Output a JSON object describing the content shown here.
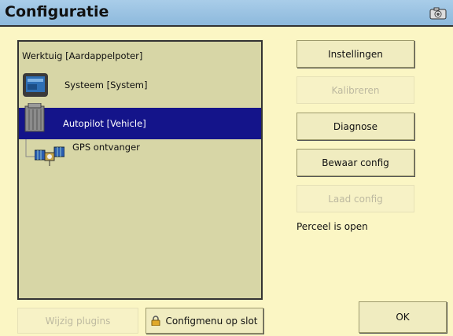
{
  "window": {
    "title": "Configuratie"
  },
  "tree": {
    "header": "Werktuig [Aardappelpoter]",
    "items": [
      {
        "label": "Systeem [System]",
        "icon": "display-unit-icon",
        "selected": false
      },
      {
        "label": "Autopilot [Vehicle]",
        "icon": "autopilot-controller-icon",
        "selected": true
      },
      {
        "label": "GPS ontvanger",
        "icon": "satellite-icon",
        "selected": false
      }
    ]
  },
  "buttons": {
    "instellingen": "Instellingen",
    "kalibreren": "Kalibreren",
    "diagnose": "Diagnose",
    "bewaar_config": "Bewaar config",
    "laad_config": "Laad config",
    "wijzig_plugins": "Wijzig plugins",
    "configmenu_lock": "Configmenu op slot",
    "ok": "OK"
  },
  "status": "Perceel is open",
  "colors": {
    "title_bar": "#8db9dc",
    "background": "#fbf6c4",
    "panel": "#d7d6a6",
    "selection": "#14148a"
  }
}
